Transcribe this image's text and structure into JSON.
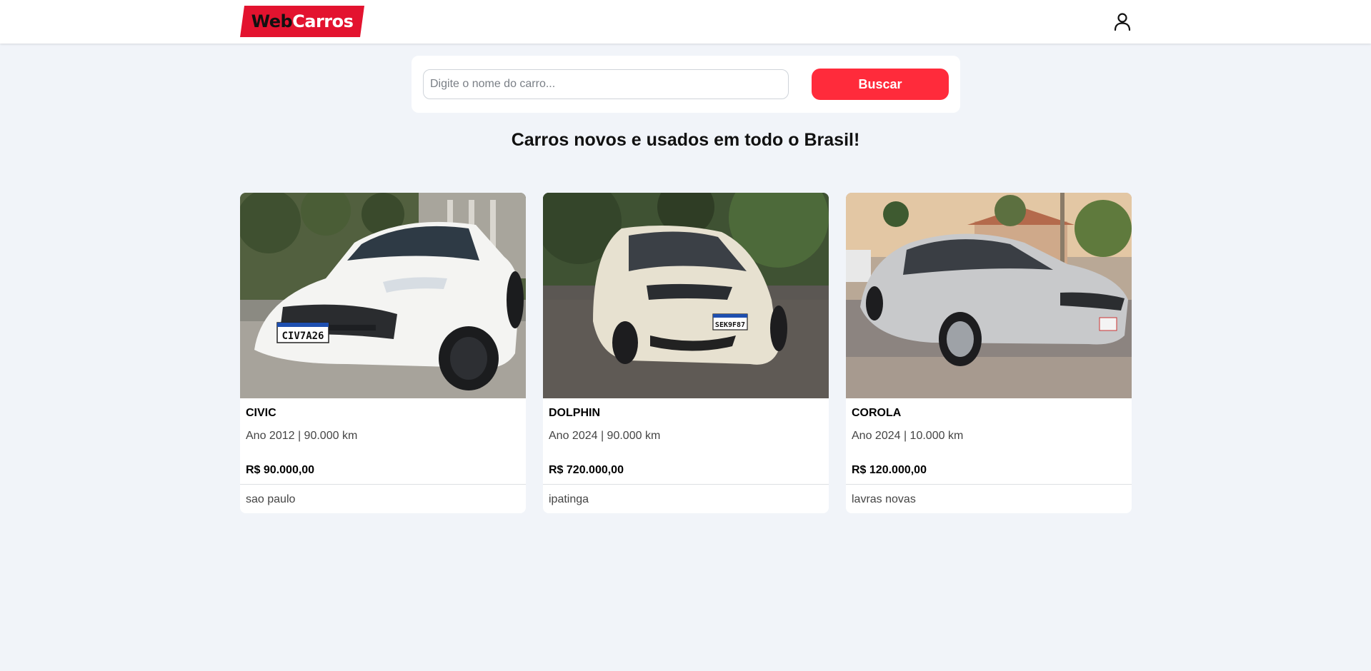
{
  "header": {
    "logo_part1": "Web",
    "logo_part2": "Carros",
    "user_icon": "user-icon"
  },
  "search": {
    "placeholder": "Digite o nome do carro...",
    "value": "",
    "button_label": "Buscar"
  },
  "headline": "Carros novos e usados em todo o Brasil!",
  "cars": [
    {
      "name": "CIVIC",
      "details": "Ano 2012 | 90.000 km",
      "price": "R$ 90.000,00",
      "city": "sao paulo",
      "plate": "CIV7A26",
      "car_color": "white"
    },
    {
      "name": "DOLPHIN",
      "details": "Ano 2024 | 90.000 km",
      "price": "R$ 720.000,00",
      "city": "ipatinga",
      "plate": "SEK9F87",
      "car_color": "cream"
    },
    {
      "name": "COROLA",
      "details": "Ano 2024 | 10.000 km",
      "price": "R$ 120.000,00",
      "city": "lavras novas",
      "plate": "",
      "car_color": "silver"
    }
  ],
  "colors": {
    "brand": "#e3132f",
    "button": "#ff2b3b",
    "background": "#f1f4f9"
  }
}
